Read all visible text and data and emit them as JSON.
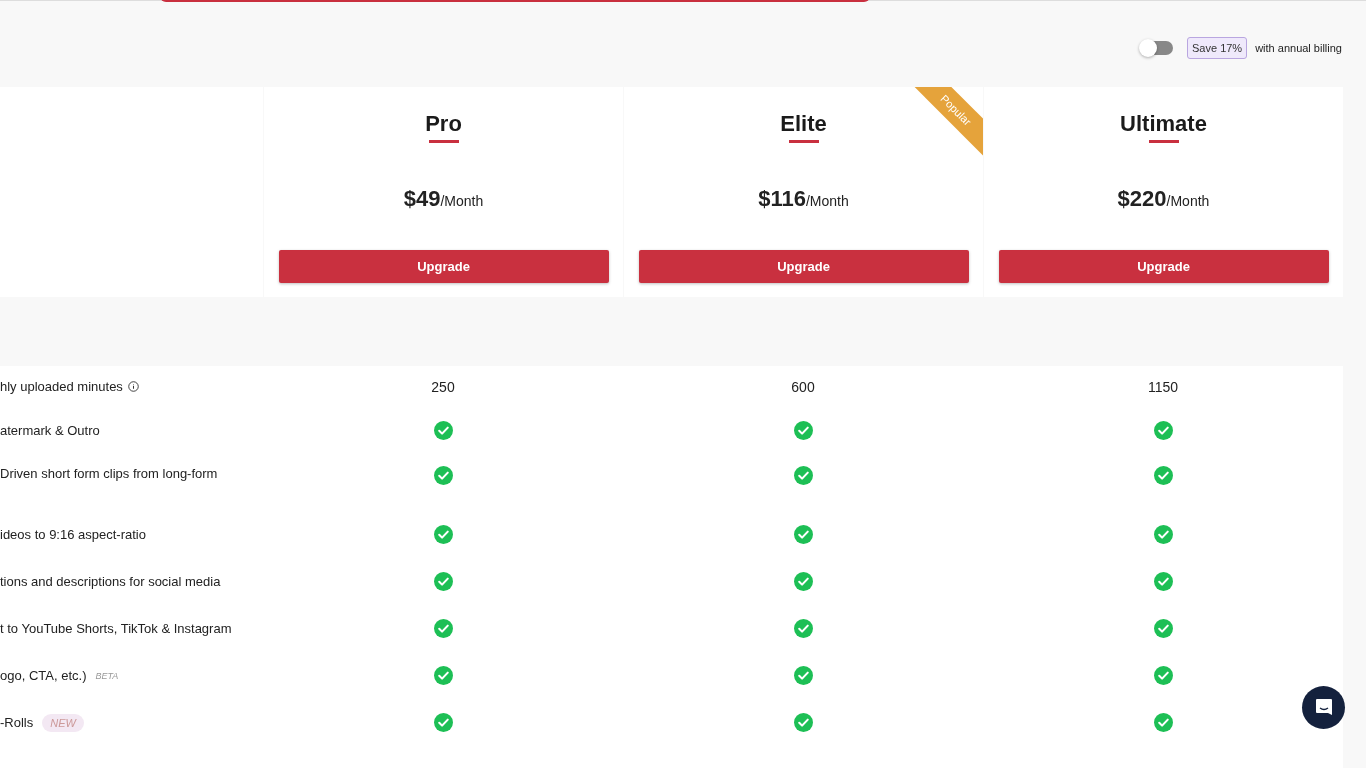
{
  "billing": {
    "annual": false,
    "save_badge": "Save 17%",
    "label": "with annual billing"
  },
  "plans": [
    {
      "name": "Pro",
      "price": "$49",
      "period": "/Month",
      "button": "Upgrade",
      "popular": false
    },
    {
      "name": "Elite",
      "price": "$116",
      "period": "/Month",
      "button": "Upgrade",
      "popular": true,
      "ribbon": "Popular"
    },
    {
      "name": "Ultimate",
      "price": "$220",
      "period": "/Month",
      "button": "Upgrade",
      "popular": false
    }
  ],
  "features": [
    {
      "label": "hly uploaded minutes",
      "info": true,
      "cells": [
        {
          "kind": "text",
          "text": "250"
        },
        {
          "kind": "text",
          "text": "600"
        },
        {
          "kind": "text",
          "text": "1150"
        }
      ]
    },
    {
      "label": "atermark & Outro",
      "cells": [
        {
          "kind": "check"
        },
        {
          "kind": "check"
        },
        {
          "kind": "check"
        }
      ]
    },
    {
      "label": "Driven short form clips from long-form",
      "cells": [
        {
          "kind": "check"
        },
        {
          "kind": "check"
        },
        {
          "kind": "check"
        }
      ]
    },
    {
      "label": "ideos to 9:16 aspect-ratio",
      "cells": [
        {
          "kind": "check"
        },
        {
          "kind": "check"
        },
        {
          "kind": "check"
        }
      ]
    },
    {
      "label": "tions and descriptions for social media",
      "cells": [
        {
          "kind": "check"
        },
        {
          "kind": "check"
        },
        {
          "kind": "check"
        }
      ]
    },
    {
      "label": "t to YouTube Shorts, TikTok & Instagram",
      "cells": [
        {
          "kind": "check"
        },
        {
          "kind": "check"
        },
        {
          "kind": "check"
        }
      ]
    },
    {
      "label": "ogo, CTA, etc.)",
      "tags": [
        {
          "kind": "beta",
          "text": "BETA"
        }
      ],
      "cells": [
        {
          "kind": "check"
        },
        {
          "kind": "check"
        },
        {
          "kind": "check"
        }
      ]
    },
    {
      "label": "-Rolls",
      "tags": [
        {
          "kind": "new",
          "text": "NEW"
        }
      ],
      "cells": [
        {
          "kind": "check"
        },
        {
          "kind": "check"
        },
        {
          "kind": "check"
        }
      ]
    }
  ]
}
